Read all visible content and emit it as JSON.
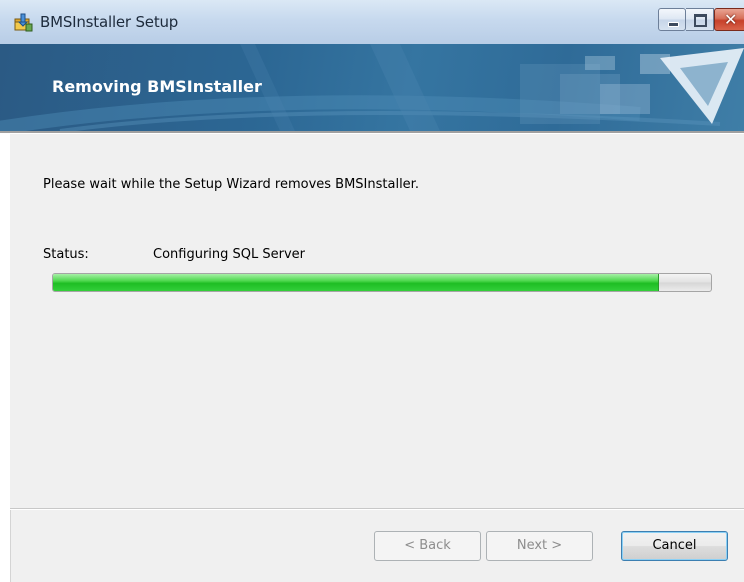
{
  "window": {
    "title": "BMSInstaller Setup",
    "close_glyph": "✕"
  },
  "banner": {
    "title": "Removing BMSInstaller"
  },
  "main": {
    "message": "Please wait while the Setup Wizard removes BMSInstaller.",
    "status_label": "Status:",
    "status_value": "Configuring SQL Server",
    "progress_percent": 92
  },
  "footer": {
    "back_label": "< Back",
    "next_label": "Next >",
    "cancel_label": "Cancel"
  },
  "colors": {
    "banner": "#2c6794",
    "progress_fill": "#1fbe24",
    "dialog_bg": "#f0f0f0"
  },
  "icons": {
    "app": "installer-box-icon",
    "minimize": "minimize-icon",
    "maximize": "maximize-icon",
    "close": "close-icon"
  }
}
